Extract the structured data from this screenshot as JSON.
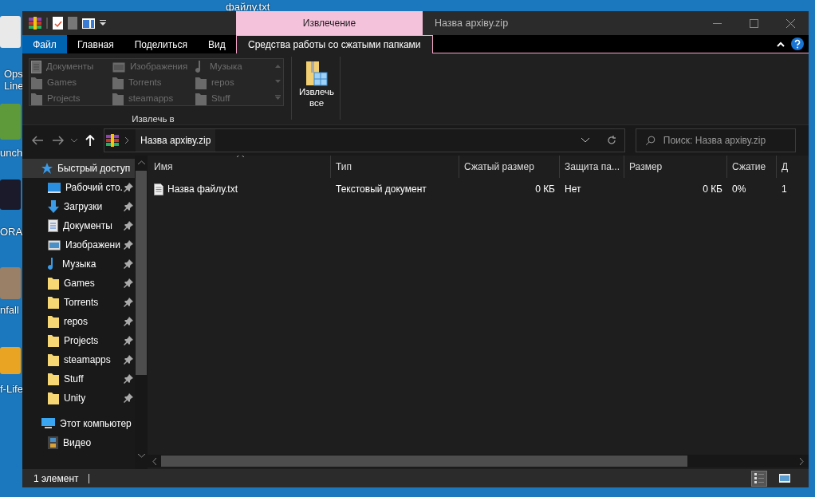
{
  "desktop": {
    "labels": [
      "файлу.txt",
      "Ops",
      "Line",
      "unch",
      "ORA",
      "nfall",
      "f-Life"
    ]
  },
  "window": {
    "title": "Назва архіву.zip",
    "contextual_tab": "Извлечение"
  },
  "ribbon": {
    "tabs": [
      {
        "label": "Файл",
        "kind": "file",
        "selected": false
      },
      {
        "label": "Главная",
        "kind": "tab",
        "selected": false
      },
      {
        "label": "Поделиться",
        "kind": "tab",
        "selected": false
      },
      {
        "label": "Вид",
        "kind": "tab",
        "selected": false
      },
      {
        "label": "Средства работы со сжатыми папками",
        "kind": "context",
        "selected": true
      }
    ],
    "gallery": [
      {
        "label": "Документы",
        "kind": "documents",
        "disabled": true
      },
      {
        "label": "Изображения",
        "kind": "pictures",
        "disabled": true
      },
      {
        "label": "Музыка",
        "kind": "music",
        "disabled": true
      },
      {
        "label": "Games",
        "kind": "folder",
        "disabled": true
      },
      {
        "label": "Torrents",
        "kind": "folder",
        "disabled": true
      },
      {
        "label": "repos",
        "kind": "folder",
        "disabled": true
      },
      {
        "label": "Projects",
        "kind": "folder",
        "disabled": true
      },
      {
        "label": "steamapps",
        "kind": "folder",
        "disabled": true
      },
      {
        "label": "Stuff",
        "kind": "folder",
        "disabled": true
      }
    ],
    "group_label": "Извлечь в",
    "extract_all": "Извлечь все"
  },
  "address": {
    "path": "Назва архіву.zip",
    "search_placeholder": "Поиск: Назва архіву.zip"
  },
  "navigation": [
    {
      "label": "Быстрый доступ",
      "kind": "star",
      "selected": true,
      "children": [
        {
          "label": "Рабочий сто.",
          "kind": "desktop",
          "pinned": true,
          "selected": false
        },
        {
          "label": "Загрузки",
          "kind": "downloads",
          "pinned": true,
          "selected": false
        },
        {
          "label": "Документы",
          "kind": "documents",
          "pinned": true,
          "selected": false
        },
        {
          "label": "Изображени",
          "kind": "pictures",
          "pinned": true,
          "selected": false
        },
        {
          "label": "Музыка",
          "kind": "music",
          "pinned": true,
          "selected": false
        },
        {
          "label": "Games",
          "kind": "folder",
          "pinned": true,
          "selected": false
        },
        {
          "label": "Torrents",
          "kind": "folder",
          "pinned": true,
          "selected": false
        },
        {
          "label": "repos",
          "kind": "folder",
          "pinned": true,
          "selected": false
        },
        {
          "label": "Projects",
          "kind": "folder",
          "pinned": true,
          "selected": false
        },
        {
          "label": "steamapps",
          "kind": "folder",
          "pinned": true,
          "selected": false
        },
        {
          "label": "Stuff",
          "kind": "folder",
          "pinned": true,
          "selected": false
        },
        {
          "label": "Unity",
          "kind": "folder",
          "pinned": true,
          "selected": false
        }
      ]
    },
    {
      "label": "Этот компьютер",
      "kind": "pc",
      "selected": false,
      "children": [
        {
          "label": "Видео",
          "kind": "video",
          "pinned": false,
          "selected": false
        }
      ]
    }
  ],
  "table": {
    "columns": [
      {
        "label": "Имя",
        "sorted": true
      },
      {
        "label": "Тип",
        "sorted": false
      },
      {
        "label": "Сжатый размер",
        "sorted": false
      },
      {
        "label": "Защита па...",
        "sorted": false
      },
      {
        "label": "Размер",
        "sorted": false
      },
      {
        "label": "Сжатие",
        "sorted": false
      },
      {
        "label": "Д",
        "sorted": false
      }
    ],
    "rows": [
      {
        "cells": [
          "Назва файлу.txt",
          "Текстовый документ",
          "0 КБ",
          "Нет",
          "0 КБ",
          "0%",
          "1"
        ],
        "selected": false
      }
    ]
  },
  "status_bar": {
    "text": "1 элемент",
    "views": [
      {
        "kind": "details",
        "selected": true
      },
      {
        "kind": "tiles",
        "selected": false
      }
    ]
  }
}
